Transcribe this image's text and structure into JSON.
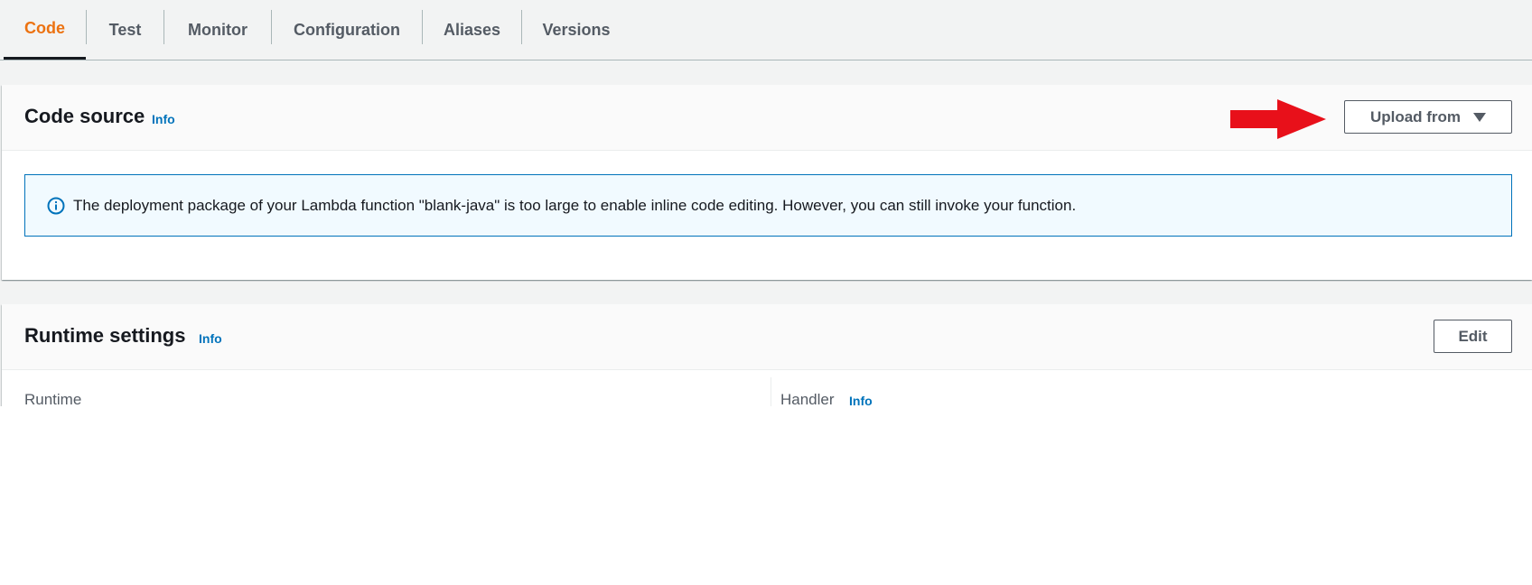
{
  "tabs": [
    {
      "label": "Code",
      "active": true
    },
    {
      "label": "Test",
      "active": false
    },
    {
      "label": "Monitor",
      "active": false
    },
    {
      "label": "Configuration",
      "active": false
    },
    {
      "label": "Aliases",
      "active": false
    },
    {
      "label": "Versions",
      "active": false
    }
  ],
  "code_source": {
    "title": "Code source",
    "info": "Info",
    "upload_button": "Upload from",
    "alert_text": "The deployment package of your Lambda function \"blank-java\" is too large to enable inline code editing. However, you can still invoke your function."
  },
  "runtime_settings": {
    "title": "Runtime settings",
    "info": "Info",
    "edit_button": "Edit",
    "runtime_label": "Runtime",
    "handler_label": "Handler",
    "handler_info": "Info"
  },
  "colors": {
    "active_tab": "#ec7211",
    "link": "#0073bb",
    "annotation_arrow": "#e8101a",
    "alert_border": "#0073bb",
    "alert_bg": "#f1faff"
  },
  "icons": {
    "upload_caret": "caret-down-icon",
    "alert": "info-circle-icon",
    "annotation": "red-arrow-icon"
  }
}
